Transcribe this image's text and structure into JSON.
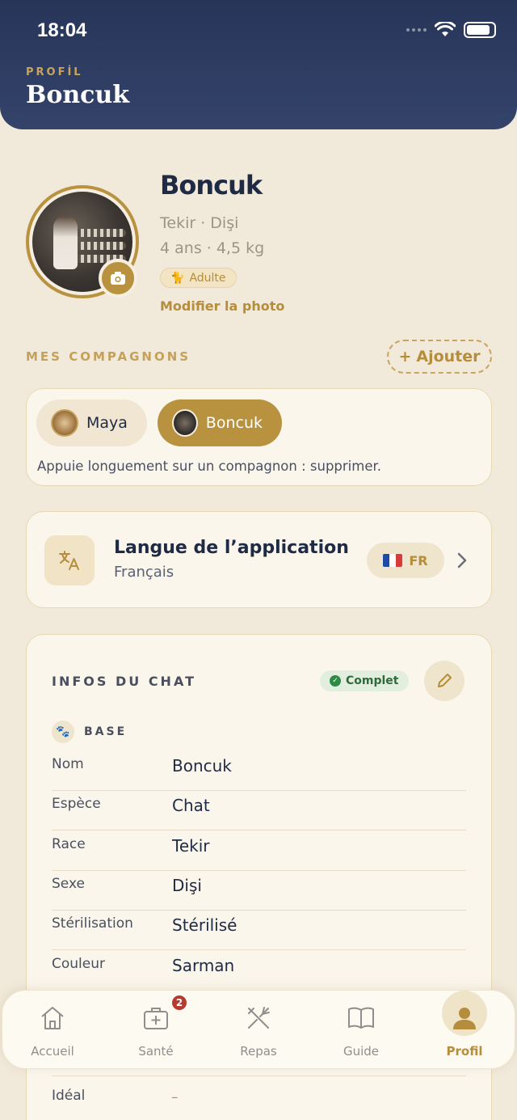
{
  "status_bar": {
    "time": "18:04"
  },
  "header": {
    "eyebrow": "PROFİL",
    "title": "Boncuk"
  },
  "profile": {
    "name": "Boncuk",
    "breed_sex": "Tekir · Dişi",
    "age_weight": "4 ans · 4,5 kg",
    "stage": "Adulte",
    "modify_photo": "Modifier la photo"
  },
  "companions": {
    "label": "MES COMPAGNONS",
    "add_label": "Ajouter",
    "items": [
      {
        "name": "Maya",
        "selected": false
      },
      {
        "name": "Boncuk",
        "selected": true
      }
    ],
    "hint": "Appuie longuement sur un compagnon : supprimer."
  },
  "language": {
    "title": "Langue de l’application",
    "current": "Français",
    "code": "FR"
  },
  "infos": {
    "title": "INFOS DU CHAT",
    "status": "Complet",
    "section": "BASE",
    "rows": [
      {
        "key": "Nom",
        "value": "Boncuk"
      },
      {
        "key": "Espèce",
        "value": "Chat"
      },
      {
        "key": "Race",
        "value": "Tekir"
      },
      {
        "key": "Sexe",
        "value": "Dişi"
      },
      {
        "key": "Stérilisation",
        "value": "Stérilisé"
      },
      {
        "key": "Couleur",
        "value": "Sarman"
      }
    ],
    "partial_row": {
      "key": "Idéal",
      "value": "–"
    }
  },
  "tabbar": {
    "items": [
      {
        "label": "Accueil",
        "icon": "home-icon"
      },
      {
        "label": "Santé",
        "icon": "medical-kit-icon",
        "badge": "2"
      },
      {
        "label": "Repas",
        "icon": "utensils-icon"
      },
      {
        "label": "Guide",
        "icon": "book-icon"
      },
      {
        "label": "Profil",
        "icon": "user-icon",
        "active": true
      }
    ]
  },
  "colors": {
    "accent": "#b8923f",
    "header": "#2c3a5e",
    "background": "#f1e9da"
  }
}
